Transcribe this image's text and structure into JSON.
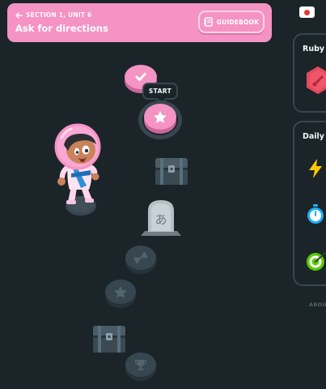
{
  "unit_banner": {
    "section_label": "SECTION 1, UNIT 6",
    "title": "Ask for directions",
    "guidebook_label": "GUIDEBOOK",
    "color": "#f493c4"
  },
  "path": {
    "start_label": "START",
    "nodes": [
      {
        "kind": "completed",
        "icon": "check-icon"
      },
      {
        "kind": "current",
        "icon": "star-icon"
      },
      {
        "kind": "chest",
        "icon": "treasure-chest-icon"
      },
      {
        "kind": "character-review",
        "icon": "tombstone-icon",
        "glyph": "あ"
      },
      {
        "kind": "locked",
        "icon": "dumbbell-icon"
      },
      {
        "kind": "locked",
        "icon": "star-icon"
      },
      {
        "kind": "chest",
        "icon": "treasure-chest-icon"
      },
      {
        "kind": "locked",
        "icon": "trophy-icon"
      }
    ]
  },
  "sidebar": {
    "flag": "japan-flag-icon",
    "league_heading": "Ruby L",
    "daily_heading": "Daily Q",
    "quest_icons": [
      "lightning-icon",
      "timer-icon",
      "target-icon"
    ],
    "about_label": "ABOUT"
  }
}
